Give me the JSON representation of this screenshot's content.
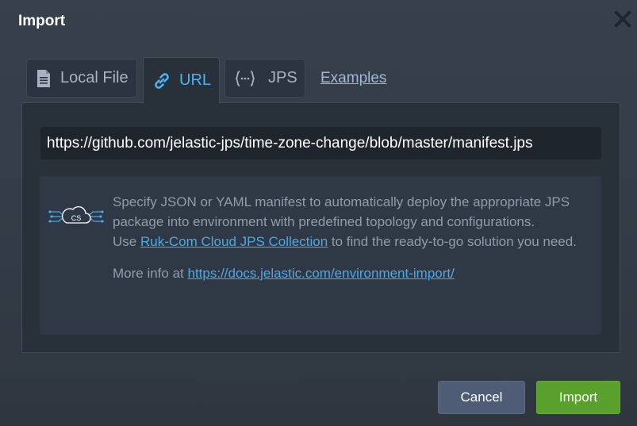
{
  "dialog": {
    "title": "Import",
    "close_icon": "close-icon"
  },
  "tabs": [
    {
      "label": "Local File",
      "icon": "file-icon",
      "active": false
    },
    {
      "label": "URL",
      "icon": "link-icon",
      "active": true
    },
    {
      "label": "JPS",
      "icon": "braces-icon",
      "active": false
    }
  ],
  "examples_link": "Examples",
  "url_field": {
    "value": "https://github.com/jelastic-jps/time-zone-change/blob/master/manifest.jps"
  },
  "info": {
    "logo_text": "CS",
    "line1": "Specify JSON or YAML manifest to automatically deploy the appropriate JPS package into environment with predefined topology and configurations.",
    "line2_prefix": "Use ",
    "line2_link": "Ruk-Com Cloud JPS Collection",
    "line2_suffix": " to find the ready-to-go solution you need.",
    "more_prefix": "More info at ",
    "more_link": "https://docs.jelastic.com/environment-import/"
  },
  "buttons": {
    "cancel": "Cancel",
    "import": "Import"
  },
  "colors": {
    "accent": "#4db3f0",
    "import_button": "#5aa02c",
    "cancel_button": "#4e5d75"
  }
}
